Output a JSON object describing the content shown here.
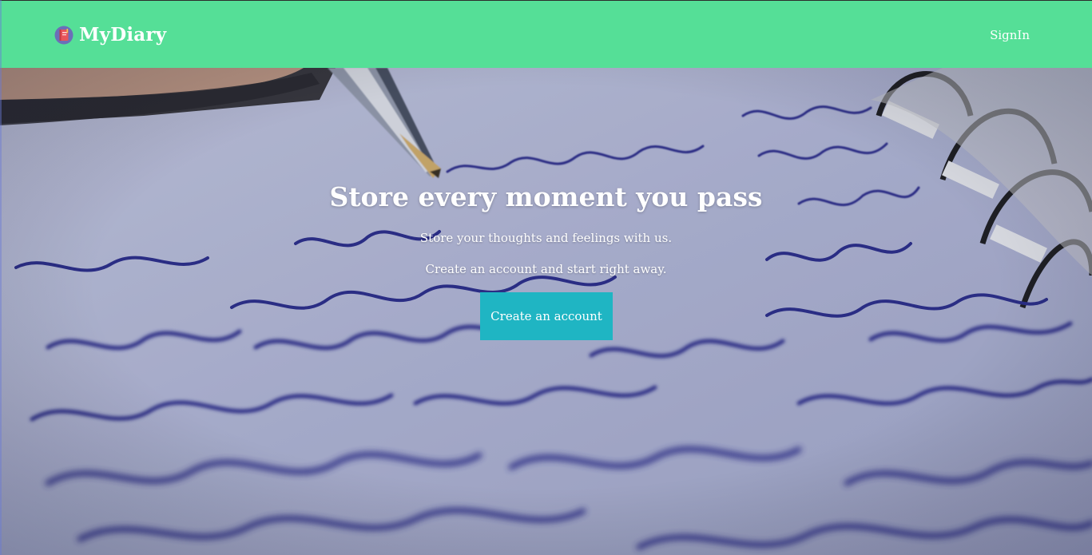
{
  "navbar": {
    "brand": "MyDiary",
    "brand_icon": "diary-book-icon",
    "signin_label": "SignIn",
    "bg_color": "#55df97"
  },
  "hero": {
    "background": "handwritten-notebook-with-pen-photo",
    "title": "Store every moment you pass",
    "subtitle_1": "Store your thoughts and feelings with us.",
    "subtitle_2": "Create an account and start right away.",
    "cta_label": "Create an account",
    "cta_color": "#1fb5c3"
  }
}
